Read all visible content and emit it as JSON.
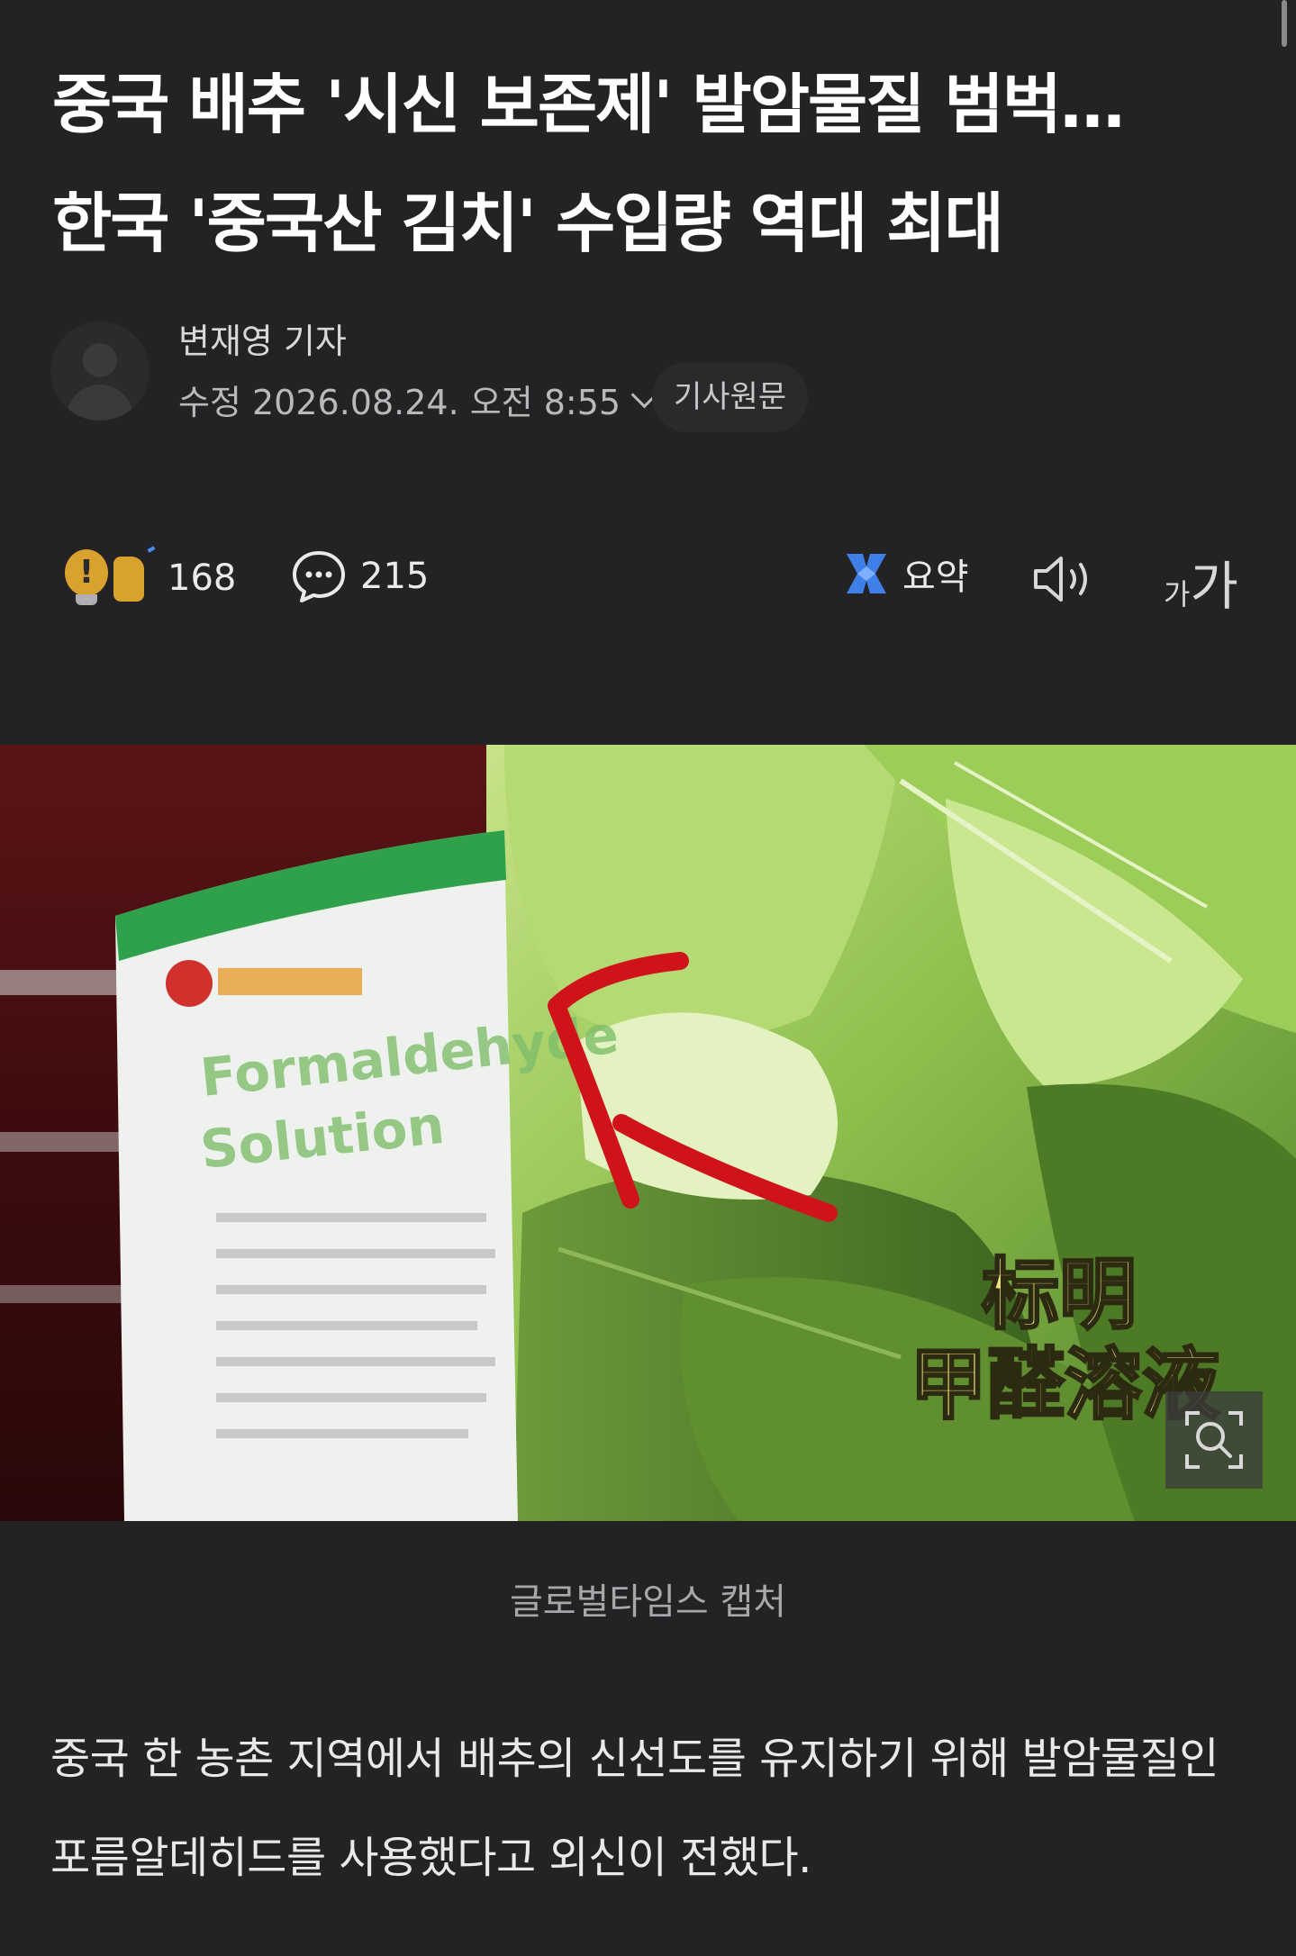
{
  "headline": {
    "line1": "중국 배추 '시신 보존제' 발암물질 범벅…",
    "line2": "한국 '중국산 김치' 수입량 역대 최대"
  },
  "byline": {
    "reporter": "변재영 기자",
    "modified": "수정 2026.08.24. 오전 8:55",
    "original_button": "기사원문"
  },
  "actions": {
    "reaction_count": "168",
    "comment_count": "215",
    "summary_label": "요약",
    "font_small": "가",
    "font_big": "가"
  },
  "photo": {
    "label_text": "Formaldehyde Solution",
    "overlay_line1": "标明",
    "overlay_line2": "甲醛溶液",
    "caption": "글로벌타임스 캡처"
  },
  "article": {
    "paragraph1": "중국 한 농촌 지역에서 배추의 신선도를 유지하기 위해 발암물질인 포름알데히드를 사용했다고 외신이 전했다."
  },
  "colors": {
    "background": "#232325",
    "reaction_yellow": "#d9a22e",
    "summary_blue": "#3f7fe8",
    "arrow_red": "#d0131b",
    "overlay_yellow": "#f3e27a"
  },
  "icons": {
    "reaction": "lightbulb-thumbs-up-icon",
    "comment": "speech-bubble-icon",
    "summary": "ai-summary-icon",
    "speaker": "speaker-icon",
    "zoom": "zoom-icon",
    "dropdown": "chevron-down-icon"
  }
}
